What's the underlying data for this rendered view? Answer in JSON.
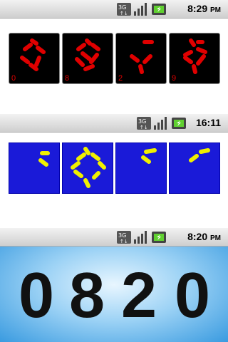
{
  "panels": [
    {
      "statusbar": {
        "time": "8:29",
        "ampm": "PM",
        "icons": [
          "3g-icon",
          "signal-icon",
          "battery-icon"
        ]
      },
      "theme": {
        "bg": "#ffffff",
        "tile": "#000000",
        "segment": "#e00000",
        "border": "#999999"
      },
      "digits": [
        {
          "label": "0"
        },
        {
          "label": "8"
        },
        {
          "label": "2"
        },
        {
          "label": "9"
        }
      ]
    },
    {
      "statusbar": {
        "time": "16:11",
        "ampm": "",
        "icons": [
          "3g-icon",
          "signal-icon",
          "battery-icon"
        ]
      },
      "theme": {
        "bg": "#ffffff",
        "tile": "#1a1ad8",
        "segment": "#f0f000",
        "border": "#0000aa"
      },
      "digits": [
        {},
        {},
        {},
        {}
      ]
    },
    {
      "statusbar": {
        "time": "8:20",
        "ampm": "PM",
        "icons": [
          "3g-icon",
          "signal-icon",
          "battery-icon"
        ]
      },
      "theme": {
        "bg": "#4aa8e8",
        "digit": "#111111"
      },
      "digits": [
        {
          "value": "0"
        },
        {
          "value": "8"
        },
        {
          "value": "2"
        },
        {
          "value": "0"
        }
      ]
    }
  ]
}
